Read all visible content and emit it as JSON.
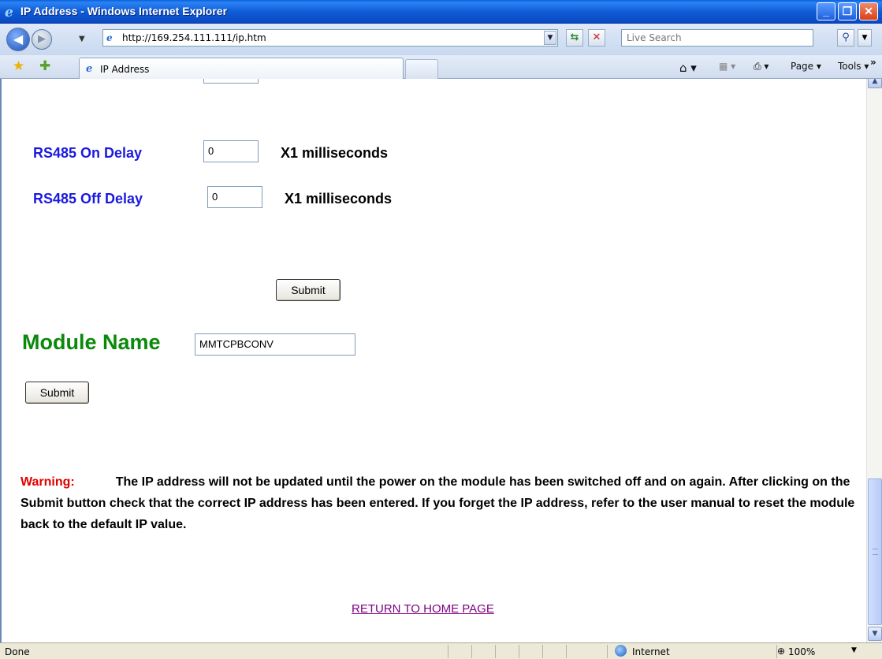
{
  "window": {
    "title": "IP Address - Windows Internet Explorer",
    "minimize": "_",
    "restore": "❐",
    "close": "✕"
  },
  "addressbar": {
    "url": "http://169.254.111.111/ip.htm",
    "search_placeholder": "Live Search"
  },
  "tabs": [
    {
      "label": "IP Address"
    }
  ],
  "commandbar": {
    "page_label": "Page ▾",
    "tools_label": "Tools ▾"
  },
  "form": {
    "rs485_on": {
      "label": "RS485 On Delay",
      "value": "0",
      "unit": "X1 milliseconds"
    },
    "rs485_off": {
      "label": "RS485 Off Delay",
      "value": "0",
      "unit": "X1 milliseconds"
    },
    "submit_label": "Submit",
    "module_name": {
      "label": "Module Name",
      "value": "MMTCPBCONV"
    },
    "submit2_label": "Submit"
  },
  "warning": {
    "label": "Warning:",
    "text": "The IP address will not be updated until the power on the module has been switched off and on again. After clicking on the Submit button check that the correct IP address has been entered. If you forget the IP address, refer to the user manual to reset the module back to the default IP value."
  },
  "home_link": "RETURN TO HOME PAGE",
  "status": {
    "text": "Done",
    "zone": "Internet",
    "zoom": "100%"
  }
}
